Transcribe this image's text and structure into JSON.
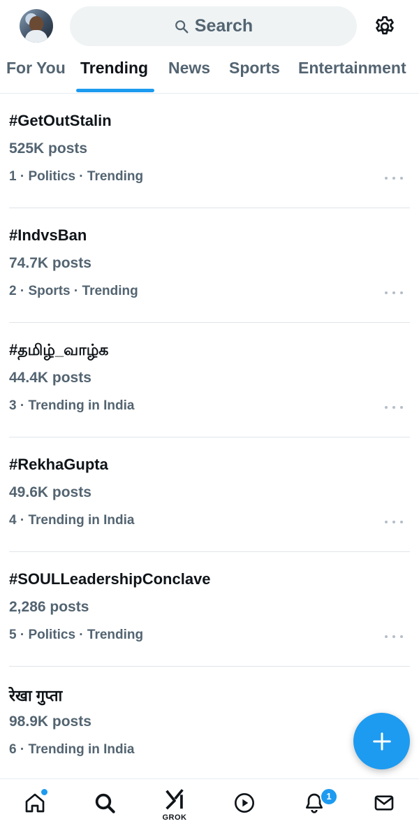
{
  "header": {
    "search_label": "Search"
  },
  "tabs": [
    {
      "label": "For You"
    },
    {
      "label": "Trending"
    },
    {
      "label": "News"
    },
    {
      "label": "Sports"
    },
    {
      "label": "Entertainment"
    }
  ],
  "active_tab": "Trending",
  "trends": [
    {
      "title": "#GetOutStalin",
      "posts": "525K posts",
      "meta": "1 · Politics · Trending"
    },
    {
      "title": "#IndvsBan",
      "posts": "74.7K posts",
      "meta": "2 · Sports · Trending"
    },
    {
      "title": "#தமிழ்_வாழ்க",
      "posts": "44.4K posts",
      "meta": "3 · Trending in India"
    },
    {
      "title": "#RekhaGupta",
      "posts": "49.6K posts",
      "meta": "4 · Trending in India"
    },
    {
      "title": "#SOULLeadershipConclave",
      "posts": "2,286 posts",
      "meta": "5 · Politics · Trending"
    },
    {
      "title": "रेखा गुप्ता",
      "posts": "98.9K posts",
      "meta": "6 · Trending in India"
    }
  ],
  "bottom_nav": {
    "items": [
      "home-icon",
      "search-icon",
      "grok-icon",
      "play-icon",
      "bell-icon",
      "mail-icon"
    ],
    "grok_label": "GROK",
    "notification_count": "1"
  },
  "colors": {
    "accent": "#1d9bf0",
    "primary_text": "#0f1419",
    "secondary_text": "#536471",
    "search_bg": "#eff3f4"
  }
}
